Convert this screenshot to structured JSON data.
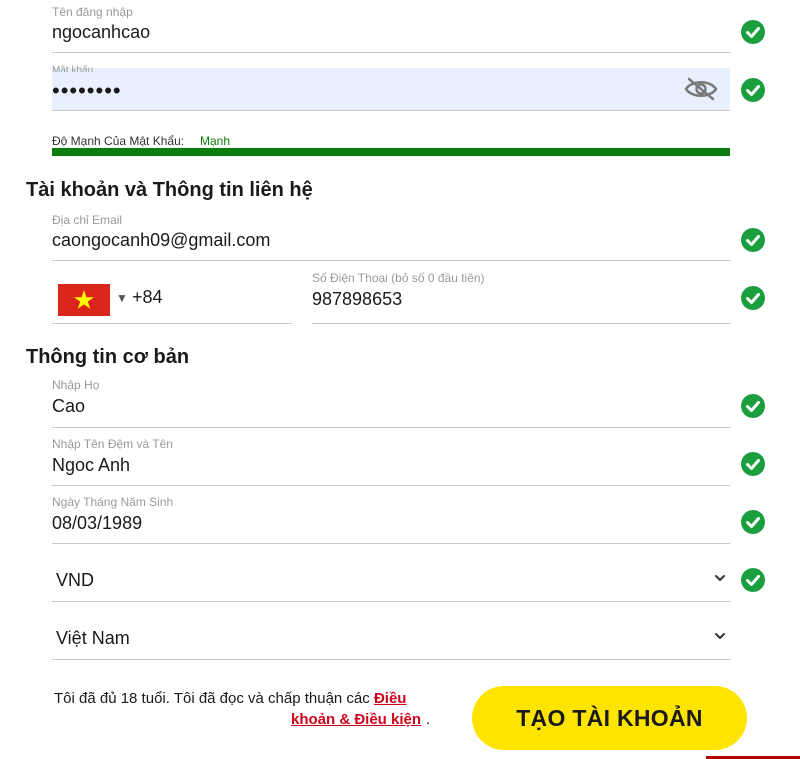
{
  "colors": {
    "check_green": "#1b9e3e",
    "strength_bar": "#0b7d0b",
    "password_bg": "#e8f0fe",
    "link_red": "#d0021b",
    "button_yellow": "#ffe400"
  },
  "icons": [
    "check-circle-icon",
    "eye-slash-icon",
    "vietnam-flag-icon",
    "caret-down-icon",
    "chevron-down-icon"
  ],
  "username": {
    "label": "Tên đăng nhập",
    "value": "ngocanhcao"
  },
  "password": {
    "label": "Mật khẩu",
    "value": "••••••••"
  },
  "strength": {
    "label": "Độ Mạnh Của Mật Khẩu:",
    "value": "Mạnh",
    "level": 1.0
  },
  "section_contact": {
    "title": "Tài khoản và Thông tin liên hệ"
  },
  "email": {
    "label": "Địa chỉ Email",
    "value": "caongocanh09@gmail.com"
  },
  "phone": {
    "country_code": "+84",
    "label": "Số Điện Thoại (bỏ số 0 đầu tiên)",
    "value": "987898653"
  },
  "section_basic": {
    "title": "Thông tin cơ bản"
  },
  "last_name": {
    "label": "Nhập Họ",
    "value": "Cao"
  },
  "first_name": {
    "label": "Nhập Tên Đệm và Tên",
    "value": "Ngoc Anh"
  },
  "birthdate": {
    "label": "Ngày Tháng Năm Sinh",
    "value": "08/03/1989"
  },
  "currency": {
    "value": "VND"
  },
  "country": {
    "value": "Việt Nam"
  },
  "terms": {
    "line1": "Tôi đã đủ 18 tuổi. Tôi đã đọc và chấp thuận các",
    "link_part1": "Điều",
    "link_part2": "khoản & Điều kiện",
    "period": "."
  },
  "submit": {
    "label": "TẠO TÀI KHOẢN"
  }
}
